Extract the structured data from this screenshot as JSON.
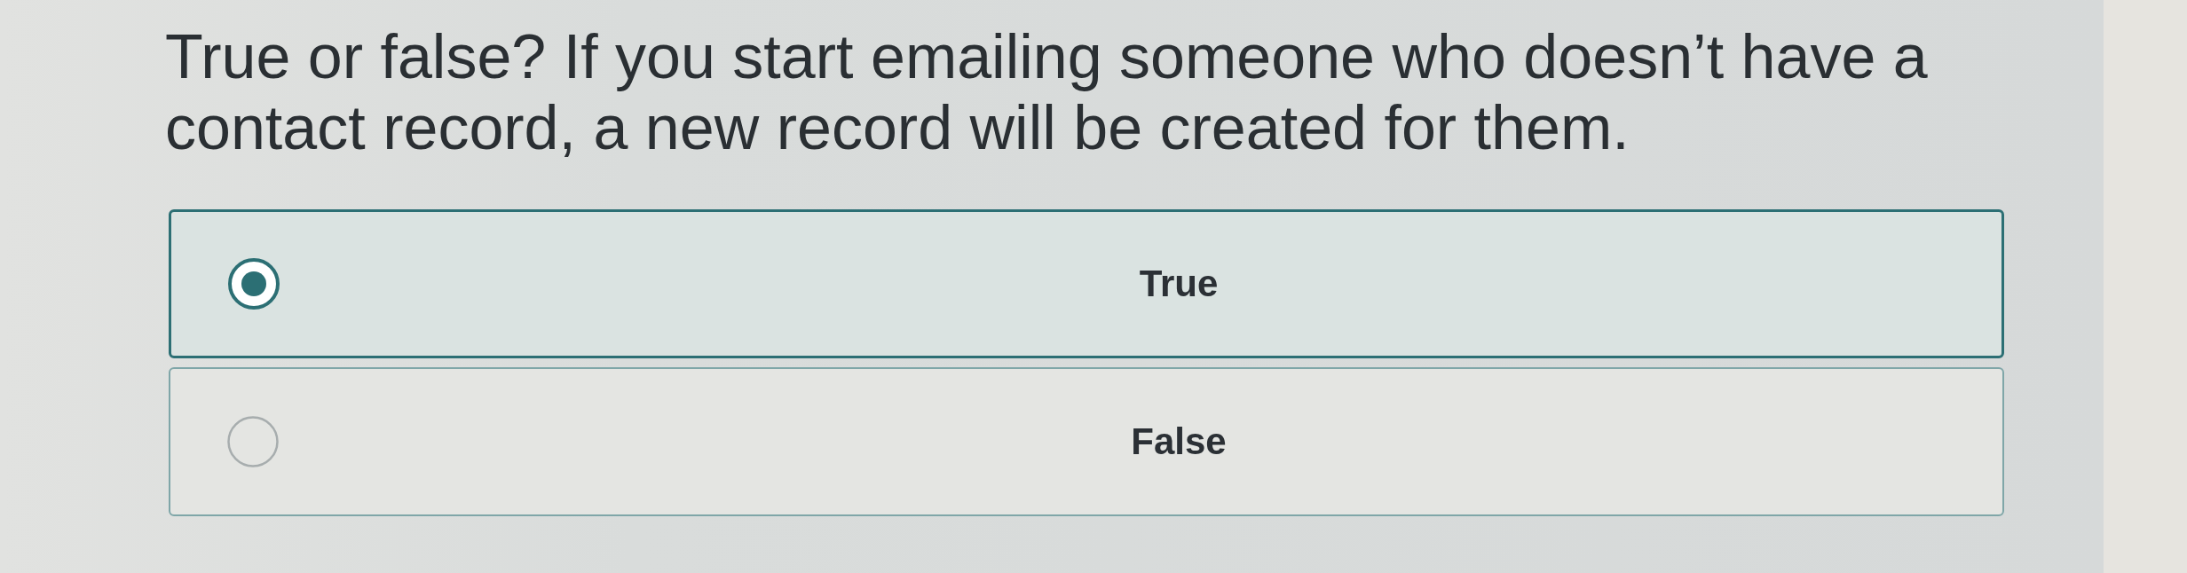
{
  "question": {
    "text": "True or false? If you start emailing someone who doesn’t have a contact record, a new record will be created for them."
  },
  "options": [
    {
      "label": "True",
      "selected": true
    },
    {
      "label": "False",
      "selected": false
    }
  ]
}
